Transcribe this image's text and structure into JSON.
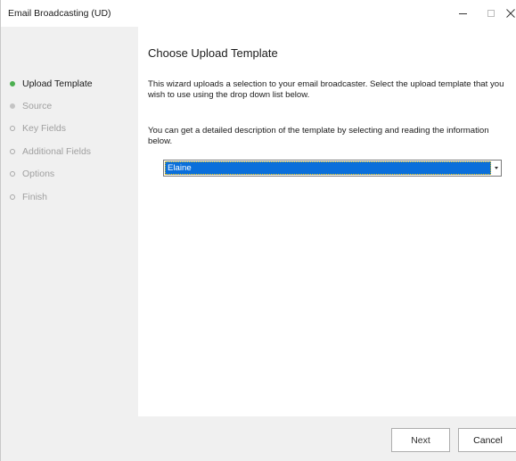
{
  "window": {
    "title": "Email Broadcasting (UD)",
    "close_glyph": "✕"
  },
  "sidebar": {
    "steps": [
      {
        "label": "Upload Template",
        "state": "current"
      },
      {
        "label": "Source",
        "state": "pending"
      },
      {
        "label": "Key Fields",
        "state": "disabled"
      },
      {
        "label": "Additional Fields",
        "state": "disabled"
      },
      {
        "label": "Options",
        "state": "disabled"
      },
      {
        "label": "Finish",
        "state": "disabled"
      }
    ]
  },
  "main": {
    "heading": "Choose Upload Template",
    "intro": "This wizard uploads a selection to your email broadcaster.  Select the upload template that you wish to use using the drop down list below.",
    "description_hint": "You can get a detailed description of the template by selecting and reading the information below.",
    "template_select": {
      "selected": "Elaine"
    }
  },
  "footer": {
    "next_label": "Next",
    "cancel_label": "Cancel"
  },
  "colors": {
    "current_step": "#4caf50",
    "selection": "#0a6fdb",
    "sidebar_bg": "#f0f0f0"
  }
}
